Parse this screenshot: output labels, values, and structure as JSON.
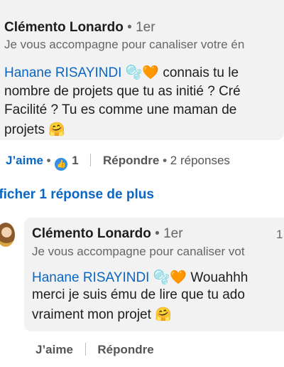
{
  "comment1": {
    "author": "Clémento Lonardo",
    "time": "1er",
    "headline": "Je vous accompagne pour canaliser votre én",
    "mention": "Hanane RISAYINDI",
    "emojis": "🫧🧡",
    "text_line1": "connais tu le",
    "text_line2": "nombre de projets que tu as initié ? Cré",
    "text_line3": "Facilité ? Tu es comme une maman de",
    "text_line4": "projets 🤗"
  },
  "comment1_actions": {
    "like_label": "J’aime",
    "reaction_count": "1",
    "reply_label": "Répondre",
    "replies_label": "2 réponses"
  },
  "more_replies_label": "fficher 1 réponse de plus",
  "comment2": {
    "author": "Clémento Lonardo",
    "time": "1er",
    "right_edge_text": "1",
    "headline": "Je vous accompagne pour canaliser vot",
    "mention": "Hanane RISAYINDI",
    "emojis": "🫧🧡",
    "text_line1": "Wouahhh",
    "text_line2": "merci je suis ému de lire que tu ado",
    "text_line3": "vraiment mon projet 🤗"
  },
  "comment2_actions": {
    "like_label": "J’aime",
    "reply_label": "Répondre"
  },
  "icons": {
    "reaction": "thumbs-up-reaction-icon",
    "avatar": "user-avatar"
  },
  "colors": {
    "mention": "#0a66c2",
    "bubble": "#f2f2f2",
    "link": "#0a66c2"
  }
}
